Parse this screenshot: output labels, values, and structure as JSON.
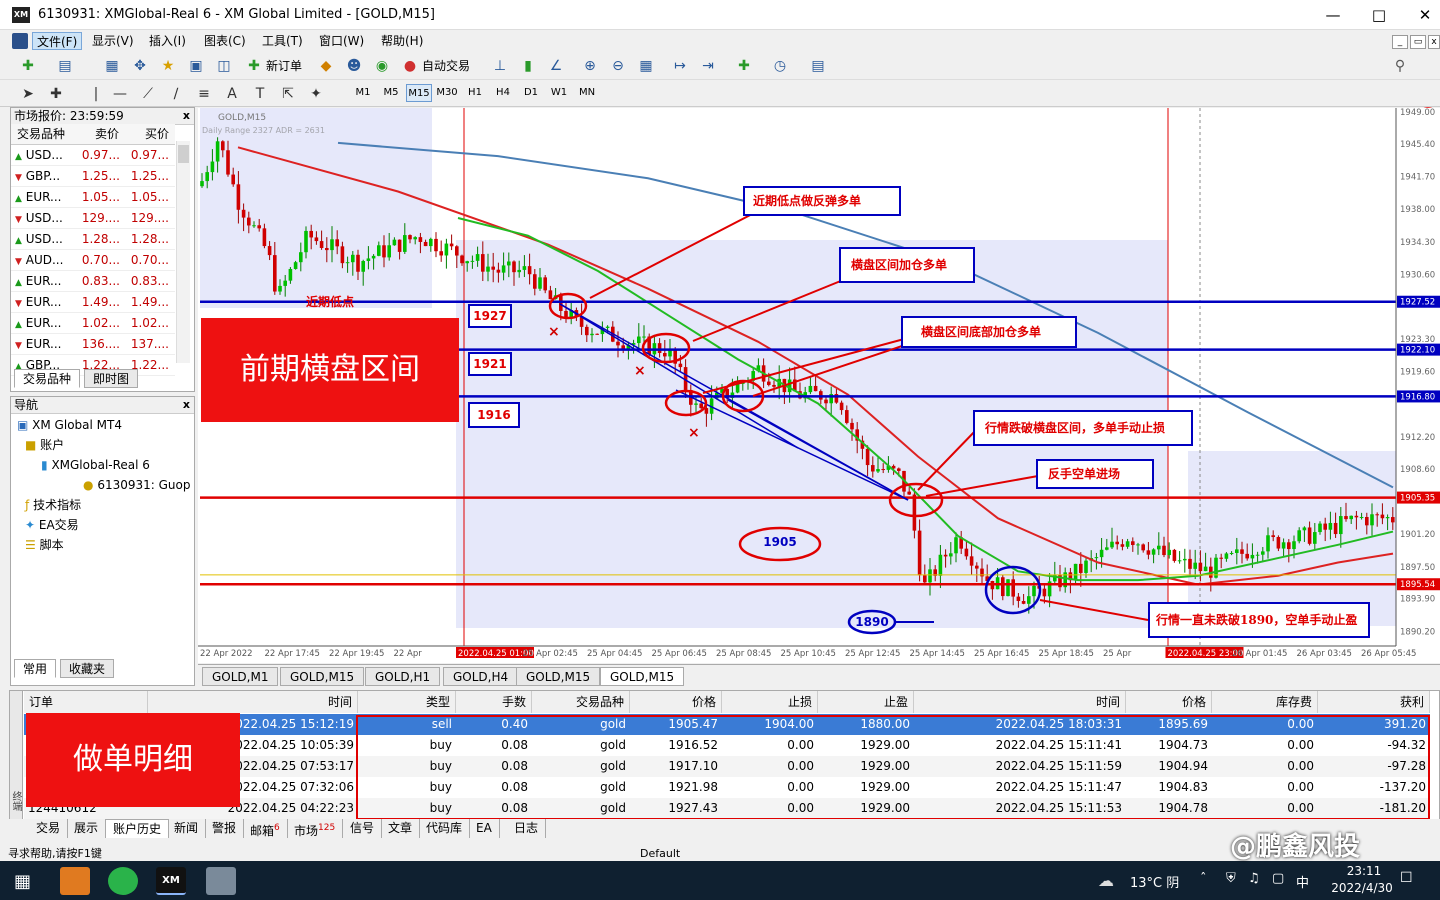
{
  "window": {
    "title": "6130931: XMGlobal-Real 6 - XM Global Limited - [GOLD,M15]",
    "logo": "XM"
  },
  "menu": [
    "文件(F)",
    "显示(V)",
    "插入(I)",
    "图表(C)",
    "工具(T)",
    "窗口(W)",
    "帮助(H)"
  ],
  "toolbar": {
    "new_order": "新订单",
    "auto_trade": "自动交易"
  },
  "timeframes": [
    "M1",
    "M5",
    "M15",
    "M30",
    "H1",
    "H4",
    "D1",
    "W1",
    "MN"
  ],
  "market_watch": {
    "title": "市场报价: 23:59:59",
    "headers": [
      "交易品种",
      "卖价",
      "买价"
    ],
    "rows": [
      {
        "s": "USD...",
        "bid": "0.97...",
        "ask": "0.97..."
      },
      {
        "s": "GBP...",
        "bid": "1.25...",
        "ask": "1.25..."
      },
      {
        "s": "EUR...",
        "bid": "1.05...",
        "ask": "1.05..."
      },
      {
        "s": "USD...",
        "bid": "129....",
        "ask": "129...."
      },
      {
        "s": "USD...",
        "bid": "1.28...",
        "ask": "1.28..."
      },
      {
        "s": "AUD...",
        "bid": "0.70...",
        "ask": "0.70..."
      },
      {
        "s": "EUR...",
        "bid": "0.83...",
        "ask": "0.83..."
      },
      {
        "s": "EUR...",
        "bid": "1.49...",
        "ask": "1.49..."
      },
      {
        "s": "EUR...",
        "bid": "1.02...",
        "ask": "1.02..."
      },
      {
        "s": "EUR...",
        "bid": "136....",
        "ask": "137...."
      },
      {
        "s": "GBP...",
        "bid": "1.22...",
        "ask": "1.22..."
      }
    ],
    "tabs": [
      "交易品种",
      "即时图"
    ]
  },
  "navigator": {
    "title": "导航",
    "items": [
      "XM Global MT4",
      "账户",
      "XMGlobal-Real 6",
      "6130931: Guop",
      "技术指标",
      "EA交易",
      "脚本"
    ],
    "tabs": [
      "常用",
      "收藏夹"
    ]
  },
  "chart": {
    "symbol": "GOLD,M15",
    "indicator": "Daily Range 2327  ADR = 2631",
    "price_labels": [
      "1949.00",
      "1945.40",
      "1941.70",
      "1938.00",
      "1934.30",
      "1930.60",
      "1927.52",
      "1923.30",
      "1922.10",
      "1919.60",
      "1916.80",
      "1912.20",
      "1908.60",
      "1905.35",
      "1901.20",
      "1897.50",
      "1895.54",
      "1893.90",
      "1890.20"
    ],
    "time_labels": [
      "22 Apr 2022",
      "22 Apr 17:45",
      "22 Apr 19:45",
      "22 Apr",
      "2022.04.25 01:00",
      "25 Apr 02:45",
      "25 Apr 04:45",
      "25 Apr 06:45",
      "25 Apr 08:45",
      "25 Apr 10:45",
      "25 Apr 12:45",
      "25 Apr 14:45",
      "25 Apr 16:45",
      "25 Apr 18:45",
      "25 Apr",
      "2022.04.25 23:00",
      "26 Apr 01:45",
      "26 Apr 03:45",
      "26 Apr 05:45"
    ],
    "annotations": {
      "range_label": "前期横盘区间",
      "recent_low": "近期低点",
      "box_1927": "1927",
      "box_1921": "1921",
      "box_1916": "1916",
      "ann1": "近期低点做反弹多单",
      "ann2": "横盘区间加仓多单",
      "ann3": "横盘区间底部加仓多单",
      "ann4": "行情跌破横盘区间，多单手动止损",
      "ann5": "反手空单进场",
      "ann6": "行情一直未跌破1890，空单手动止盈",
      "oval_1905": "1905",
      "oval_1890": "1890"
    }
  },
  "chart_tabs": [
    "GOLD,M1",
    "GOLD,M15",
    "GOLD,H1",
    "GOLD,H4",
    "GOLD,M15",
    "GOLD,M15"
  ],
  "terminal": {
    "headers": [
      "订单",
      "时间",
      "类型",
      "手数",
      "交易品种",
      "价格",
      "止损",
      "止盈",
      "时间",
      "价格",
      "库存费",
      "获利"
    ],
    "rows": [
      {
        "order": "",
        "time": "2022.04.25 15:12:19",
        "type": "sell",
        "lots": "0.40",
        "sym": "gold",
        "price": "1905.47",
        "sl": "1904.00",
        "tp": "1880.00",
        "ctime": "2022.04.25 18:03:31",
        "cprice": "1895.69",
        "swap": "0.00",
        "profit": "391.20"
      },
      {
        "order": "",
        "time": "2022.04.25 10:05:39",
        "type": "buy",
        "lots": "0.08",
        "sym": "gold",
        "price": "1916.52",
        "sl": "0.00",
        "tp": "1929.00",
        "ctime": "2022.04.25 15:11:41",
        "cprice": "1904.73",
        "swap": "0.00",
        "profit": "-94.32"
      },
      {
        "order": "",
        "time": "2022.04.25 07:53:17",
        "type": "buy",
        "lots": "0.08",
        "sym": "gold",
        "price": "1917.10",
        "sl": "0.00",
        "tp": "1929.00",
        "ctime": "2022.04.25 15:11:59",
        "cprice": "1904.94",
        "swap": "0.00",
        "profit": "-97.28"
      },
      {
        "order": "",
        "time": "2022.04.25 07:32:06",
        "type": "buy",
        "lots": "0.08",
        "sym": "gold",
        "price": "1921.98",
        "sl": "0.00",
        "tp": "1929.00",
        "ctime": "2022.04.25 15:11:47",
        "cprice": "1904.83",
        "swap": "0.00",
        "profit": "-137.20"
      },
      {
        "order": "124410612",
        "time": "2022.04.25 04:22:23",
        "type": "buy",
        "lots": "0.08",
        "sym": "gold",
        "price": "1927.43",
        "sl": "0.00",
        "tp": "1929.00",
        "ctime": "2022.04.25 15:11:53",
        "cprice": "1904.78",
        "swap": "0.00",
        "profit": "-181.20"
      }
    ],
    "overlay_label": "做单明细",
    "side_label": "终端"
  },
  "bottom_tabs": [
    {
      "l": "交易"
    },
    {
      "l": "展示"
    },
    {
      "l": "账户历史"
    },
    {
      "l": "新闻"
    },
    {
      "l": "警报"
    },
    {
      "l": "邮箱",
      "b": "6"
    },
    {
      "l": "市场",
      "b": "125"
    },
    {
      "l": "信号"
    },
    {
      "l": "文章"
    },
    {
      "l": "代码库"
    },
    {
      "l": "EA"
    },
    {
      "l": "日志"
    }
  ],
  "status": {
    "help": "寻求帮助,请按F1键",
    "profile": "Default"
  },
  "taskbar": {
    "weather": "13°C 阴",
    "ime": "中",
    "time": "23:11",
    "date": "2022/4/30",
    "watermark": "@鹏鑫风投"
  },
  "colors": {
    "bull": "#00c000",
    "bear": "#d00000",
    "hline_blue": "#0000c0",
    "hline_red": "#e00000",
    "range_fill": "#e6e8fa",
    "ma_blue": "#4a7fb5",
    "ma_red": "#dd2222",
    "ma_green": "#22bb22"
  }
}
